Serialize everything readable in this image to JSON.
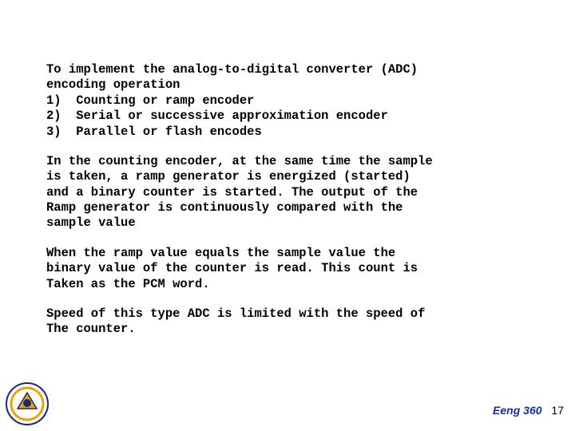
{
  "paragraphs": [
    "To implement the analog-to-digital converter (ADC)\nencoding operation\n1)  Counting or ramp encoder\n2)  Serial or successive approximation encoder\n3)  Parallel or flash encodes",
    "In the counting encoder, at the same time the sample\nis taken, a ramp generator is energized (started)\nand a binary counter is started. The output of the\nRamp generator is continuously compared with the\nsample value",
    "When the ramp value equals the sample value the\nbinary value of the counter is read. This count is\nTaken as the PCM word.",
    "Speed of this type ADC is limited with the speed of\nThe counter."
  ],
  "footer": {
    "brand": "Eeng 360",
    "page_number": "17"
  }
}
